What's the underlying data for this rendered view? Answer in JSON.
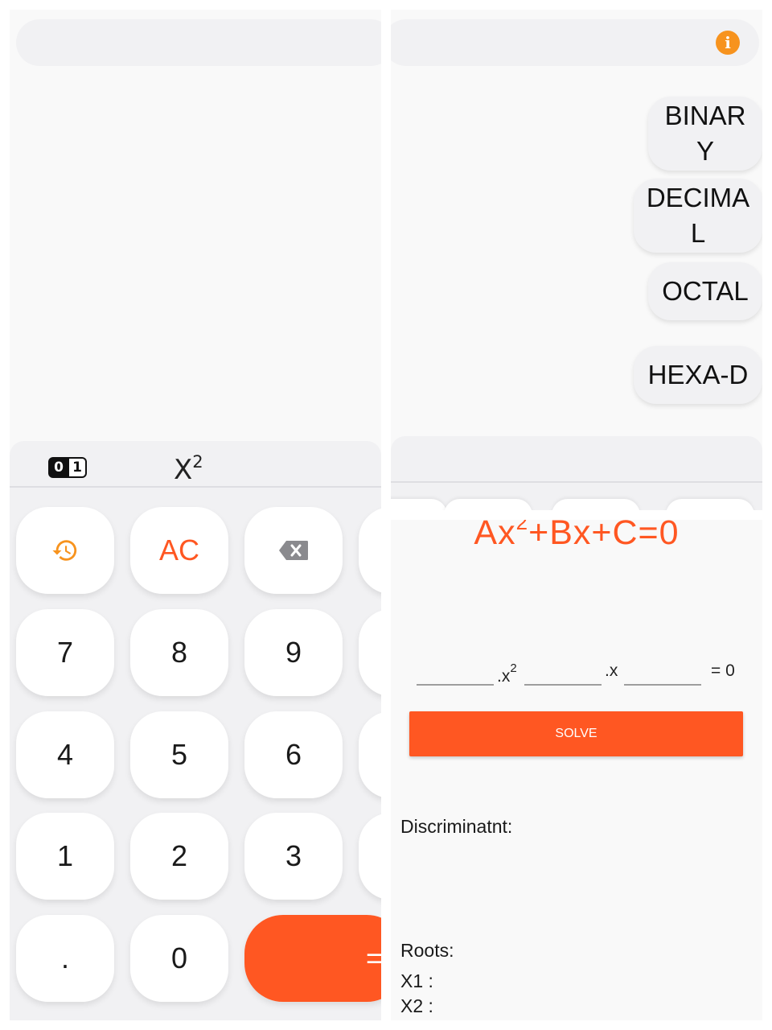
{
  "left_panel": {
    "mode_bar": {
      "binary_zero": "0",
      "binary_one": "1",
      "square_base": "X",
      "square_exp": "2"
    },
    "keys": {
      "ac": "AC",
      "seven": "7",
      "eight": "8",
      "nine": "9",
      "four": "4",
      "five": "5",
      "six": "6",
      "one": "1",
      "two": "2",
      "three": "3",
      "dot": ".",
      "zero": "0",
      "equals": "="
    }
  },
  "converter_panel": {
    "info_icon_glyph": "i",
    "binary_line1": "BINAR",
    "binary_line2": "Y",
    "decimal_line1": "DECIMA",
    "decimal_line2": "L",
    "octal": "OCTAL",
    "hexa": "HEXA-D"
  },
  "quadratic_panel": {
    "title_a": "Ax",
    "title_exp": "2",
    "title_b": "+Bx+C=0",
    "x2_label": ".x",
    "x2_exp": "2",
    "x_label": ".x",
    "eq_zero": "= 0",
    "solve": "SOLVE",
    "discriminant_label": "Discriminatnt:",
    "roots_label": "Roots:",
    "x1_label": "X1 :",
    "x2_root_label": "X2 :"
  },
  "colors": {
    "accent": "#ff5722",
    "info": "#f7931e",
    "key_bg": "#ffffff",
    "panel_bg": "#f1f1f3"
  }
}
